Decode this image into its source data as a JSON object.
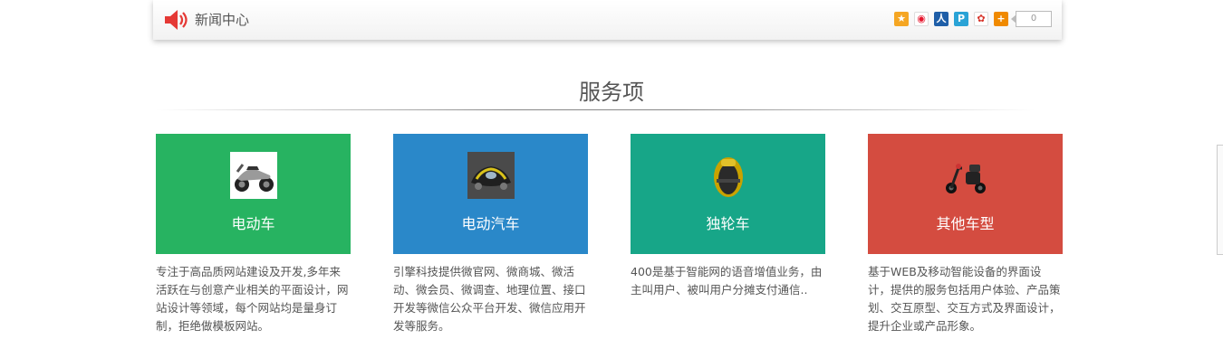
{
  "news_bar": {
    "title": "新闻中心",
    "share_count": "0",
    "share_icons": [
      {
        "name": "qzone-icon",
        "color": "#f5a623",
        "glyph": "★"
      },
      {
        "name": "weibo-icon",
        "color": "#e6162d",
        "glyph": "◉"
      },
      {
        "name": "renren-icon",
        "color": "#1f5fa8",
        "glyph": "人"
      },
      {
        "name": "pengyou-icon",
        "color": "#2aa3d6",
        "glyph": "P"
      },
      {
        "name": "tencent-weibo-icon",
        "color": "#d7342a",
        "glyph": "✿"
      },
      {
        "name": "more-share-icon",
        "color": "#f08a00",
        "glyph": "+"
      }
    ]
  },
  "section": {
    "title": "服务项"
  },
  "services": [
    {
      "label": "电动车",
      "color": "#27b361",
      "icon": "motor-scooter-icon",
      "description": "专注于高品质网站建设及开发,多年来活跃在与创意产业相关的平面设计，网站设计等领域，每个网站均是量身订制，拒绝做模板网站。"
    },
    {
      "label": "电动汽车",
      "color": "#2a88c9",
      "icon": "electric-car-icon",
      "description": "引擎科技提供微官网、微商城、微活动、微会员、微调查、地理位置、接口开发等微信公众平台开发、微信应用开发等服务。"
    },
    {
      "label": "独轮车",
      "color": "#17a688",
      "icon": "unicycle-icon",
      "description": "400是基于智能网的语音增值业务，由主叫用户、被叫用户分摊支付通信.."
    },
    {
      "label": "其他车型",
      "color": "#d44c40",
      "icon": "tricycle-scooter-icon",
      "description": "基于WEB及移动智能设备的界面设计，提供的服务包括用户体验、产品策划、交互原型、交互方式及界面设计，提升企业或产品形象。"
    }
  ]
}
